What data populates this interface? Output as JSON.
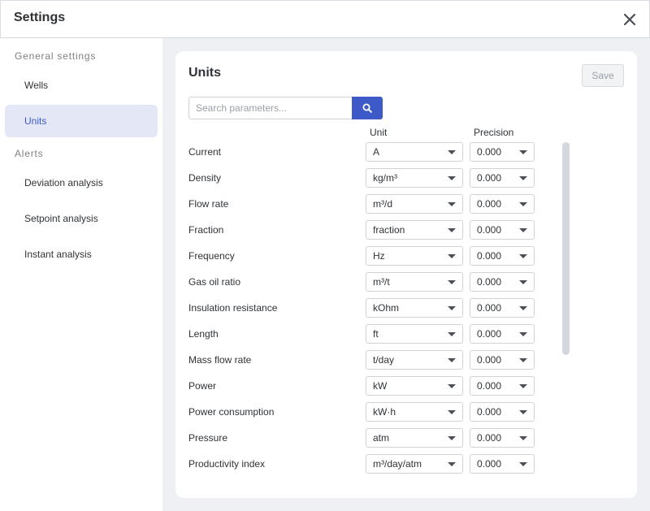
{
  "window": {
    "title": "Settings"
  },
  "sidebar": {
    "general_title": "General settings",
    "alerts_title": "Alerts",
    "items": [
      {
        "label": "Wells"
      },
      {
        "label": "Units"
      },
      {
        "label": "Deviation analysis"
      },
      {
        "label": "Setpoint analysis"
      },
      {
        "label": "Instant analysis"
      }
    ],
    "active": "Units"
  },
  "main": {
    "title": "Units",
    "save_label": "Save",
    "search_placeholder": "Search parameters...",
    "columns": {
      "unit": "Unit",
      "precision": "Precision"
    },
    "rows": [
      {
        "label": "Current",
        "unit": "A",
        "precision": "0.000"
      },
      {
        "label": "Density",
        "unit": "kg/m³",
        "precision": "0.000"
      },
      {
        "label": "Flow rate",
        "unit": "m³/d",
        "precision": "0.000"
      },
      {
        "label": "Fraction",
        "unit": "fraction",
        "precision": "0.000"
      },
      {
        "label": "Frequency",
        "unit": "Hz",
        "precision": "0.000"
      },
      {
        "label": "Gas oil ratio",
        "unit": "m³/t",
        "precision": "0.000"
      },
      {
        "label": "Insulation resistance",
        "unit": "kOhm",
        "precision": "0.000"
      },
      {
        "label": "Length",
        "unit": "ft",
        "precision": "0.000"
      },
      {
        "label": "Mass flow rate",
        "unit": "t/day",
        "precision": "0.000"
      },
      {
        "label": "Power",
        "unit": "kW",
        "precision": "0.000"
      },
      {
        "label": "Power consumption",
        "unit": "kW·h",
        "precision": "0.000"
      },
      {
        "label": "Pressure",
        "unit": "atm",
        "precision": "0.000"
      },
      {
        "label": "Productivity index",
        "unit": "m³/day/atm",
        "precision": "0.000"
      }
    ]
  },
  "colors": {
    "accent": "#3d5ac8",
    "active_bg": "#e4e7f6",
    "main_bg": "#eef0f3"
  },
  "icons": {
    "close": "close-icon",
    "search": "search-icon",
    "dropdown": "chevron-down-icon"
  }
}
